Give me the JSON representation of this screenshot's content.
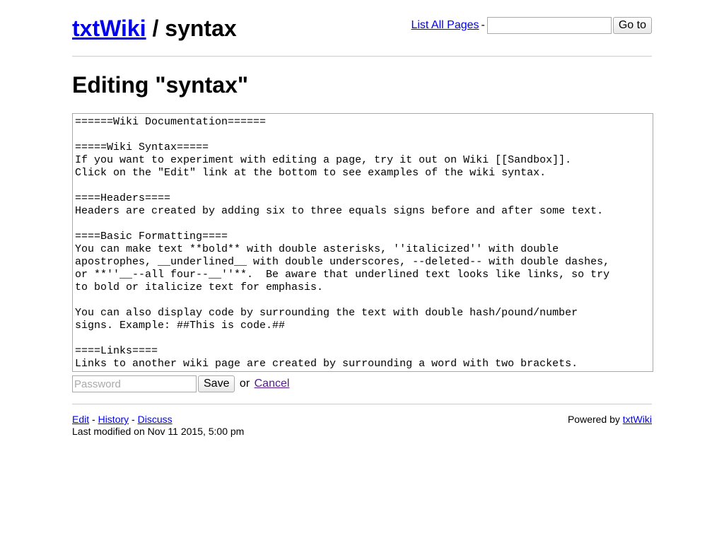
{
  "header": {
    "site_link": "txtWiki",
    "separator": "/",
    "page_name": "syntax",
    "list_all_pages": "List All Pages",
    "dash": "-",
    "goto_value": "",
    "goto_button": "Go to"
  },
  "main": {
    "heading": "Editing \"syntax\"",
    "editor_content": "======Wiki Documentation======\n\n=====Wiki Syntax=====\nIf you want to experiment with editing a page, try it out on Wiki [[Sandbox]].\nClick on the \"Edit\" link at the bottom to see examples of the wiki syntax.\n\n====Headers====\nHeaders are created by adding six to three equals signs before and after some text.\n\n====Basic Formatting====\nYou can make text **bold** with double asterisks, ''italicized'' with double\napostrophes, __underlined__ with double underscores, --deleted-- with double dashes,\nor **''__--all four--__''**.  Be aware that underlined text looks like links, so try\nto bold or italicize text for emphasis.\n\nYou can also display code by surrounding the text with double hash/pound/number\nsigns. Example: ##This is code.##\n\n====Links====\nLinks to another wiki page are created by surrounding a word with two brackets.",
    "password_placeholder": "Password",
    "save_button": "Save",
    "or_text": "or",
    "cancel_link": "Cancel"
  },
  "footer": {
    "edit_link": "Edit",
    "history_link": "History",
    "discuss_link": "Discuss",
    "dash": "-",
    "last_modified": "Last modified on Nov 11 2015, 5:00 pm",
    "powered_by": "Powered by",
    "powered_link": "txtWiki"
  }
}
